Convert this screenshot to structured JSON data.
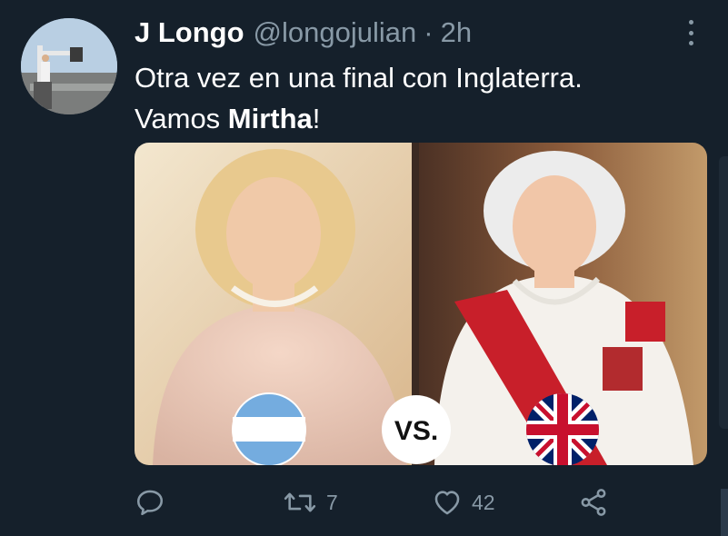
{
  "tweet": {
    "author_name": "J Longo",
    "handle": "@longojulian",
    "separator": "·",
    "time": "2h",
    "text_line1": "Otra vez en una final con Inglaterra.",
    "text_line2_prefix": "Vamos ",
    "text_line2_bold": "Mirtha",
    "text_line2_suffix": "!",
    "media": {
      "vs_label": "VS.",
      "left_flag": "argentina-flag",
      "right_flag": "union-jack-flag"
    }
  },
  "actions": {
    "reply": {
      "icon": "reply-icon",
      "count": ""
    },
    "retweet": {
      "icon": "retweet-icon",
      "count": "7"
    },
    "like": {
      "icon": "heart-icon",
      "count": "42"
    },
    "share": {
      "icon": "share-icon",
      "count": ""
    }
  },
  "colors": {
    "background": "#15202b",
    "primary_text": "#ffffff",
    "secondary_text": "#8899a6"
  }
}
